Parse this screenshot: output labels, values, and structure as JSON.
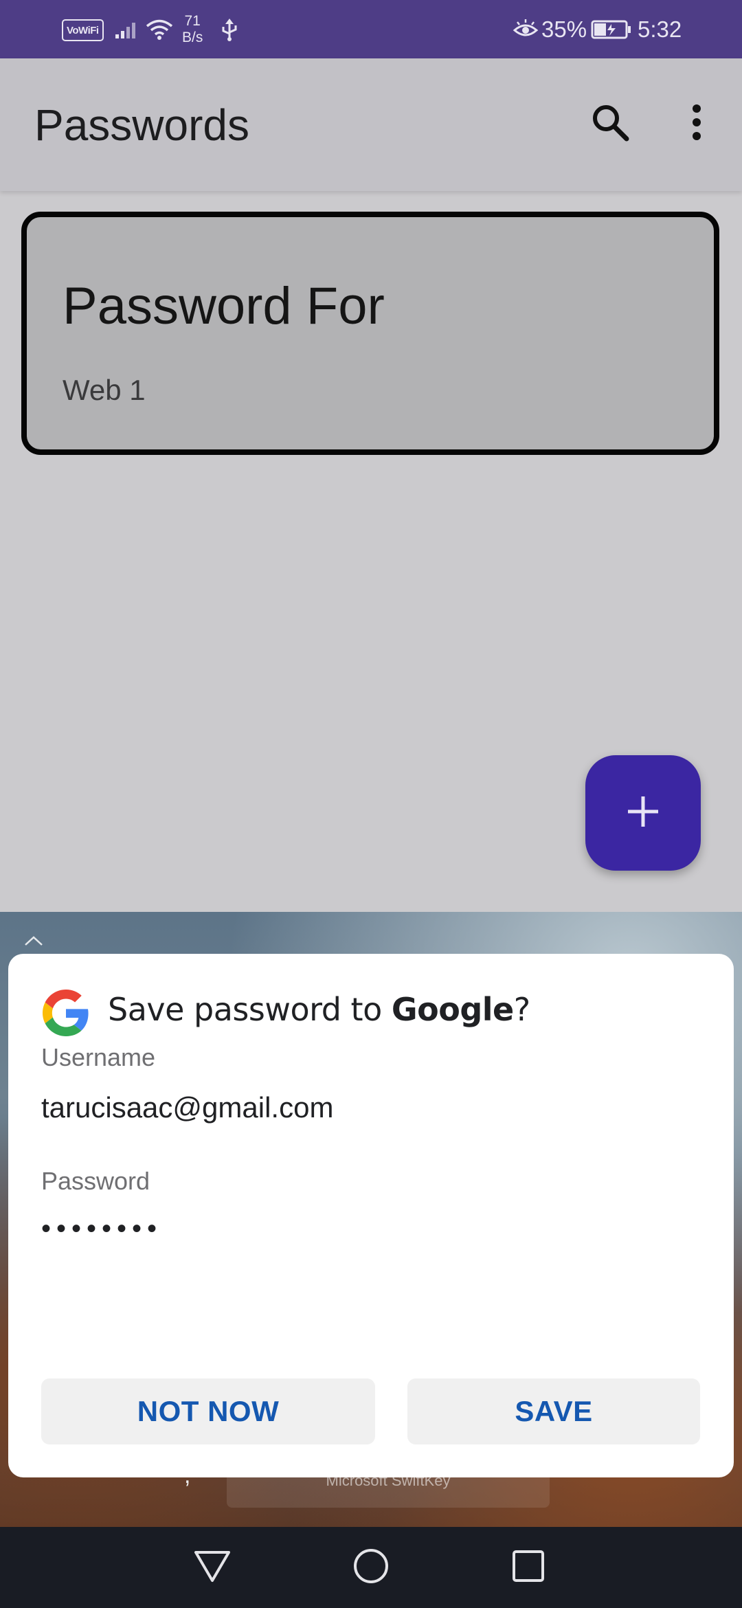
{
  "status_bar": {
    "vowifi_label": "VoWiFi",
    "net_speed_value": "71",
    "net_speed_unit": "B/s",
    "battery_percent": "35%",
    "time": "5:32"
  },
  "app_bar": {
    "title": "Passwords",
    "search_icon": "search-icon",
    "more_icon": "more-vert-icon"
  },
  "password_list": [
    {
      "title": "Password For",
      "subtitle": "Web 1"
    }
  ],
  "fab": {
    "icon": "plus-icon",
    "color": "#3b26a2"
  },
  "keyboard": {
    "name": "Microsoft SwiftKey",
    "comma": ","
  },
  "dialog": {
    "title_prefix": "Save password to ",
    "title_brand": "Google",
    "title_suffix": "?",
    "username_label": "Username",
    "username_value": "tarucisaac@gmail.com",
    "password_label": "Password",
    "password_value": "••••••••",
    "not_now_label": "NOT NOW",
    "save_label": "SAVE",
    "button_text_color": "#1558b0"
  },
  "nav_bar": {
    "back_icon": "back-triangle-icon",
    "home_icon": "home-circle-icon",
    "recents_icon": "recents-square-icon"
  },
  "colors": {
    "status_bar": "#4e3d86",
    "app_bar": "#c2c1c6",
    "background": "#cbcacd",
    "nav_bar": "#191c24"
  }
}
